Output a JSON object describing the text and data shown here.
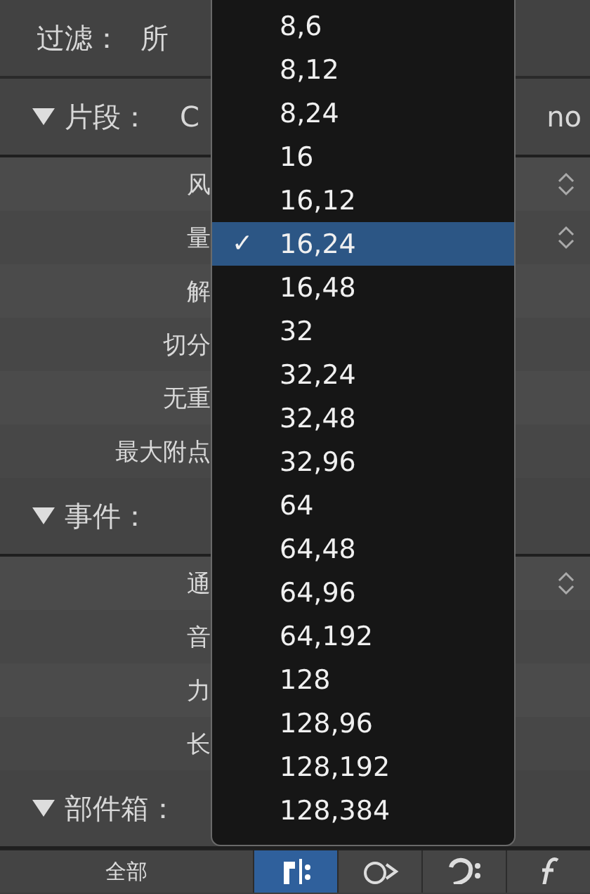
{
  "filter": {
    "label": "过滤：",
    "value": "所"
  },
  "sections": [
    {
      "title": "片段：",
      "value": "C",
      "trailing": "no",
      "expanded": true,
      "rows": [
        {
          "label": "风",
          "kind": "popup"
        },
        {
          "label": "量",
          "kind": "popup"
        },
        {
          "label": "解",
          "kind": "plain"
        },
        {
          "label": "切分",
          "kind": "plain"
        },
        {
          "label": "无重",
          "kind": "plain"
        },
        {
          "label": "最大附点",
          "kind": "plain"
        }
      ]
    },
    {
      "title": "事件：",
      "expanded": true,
      "rows": [
        {
          "label": "通",
          "kind": "popup"
        },
        {
          "label": "音",
          "kind": "plain"
        },
        {
          "label": "力",
          "kind": "plain"
        },
        {
          "label": "长",
          "kind": "plain"
        }
      ]
    },
    {
      "title": "部件箱：",
      "expanded": true
    }
  ],
  "toolbar": {
    "all_button": "全部",
    "tabs": [
      {
        "kind": "notes",
        "selected": true
      },
      {
        "kind": "symbols",
        "selected": false
      },
      {
        "kind": "clef",
        "selected": false
      },
      {
        "kind": "dynamics",
        "selected": false
      }
    ]
  },
  "menu": {
    "items": [
      {
        "label": "8,6",
        "selected": false
      },
      {
        "label": "8,12",
        "selected": false
      },
      {
        "label": "8,24",
        "selected": false
      },
      {
        "label": "16",
        "selected": false
      },
      {
        "label": "16,12",
        "selected": false
      },
      {
        "label": "16,24",
        "selected": true
      },
      {
        "label": "16,48",
        "selected": false
      },
      {
        "label": "32",
        "selected": false
      },
      {
        "label": "32,24",
        "selected": false
      },
      {
        "label": "32,48",
        "selected": false
      },
      {
        "label": "32,96",
        "selected": false
      },
      {
        "label": "64",
        "selected": false
      },
      {
        "label": "64,48",
        "selected": false
      },
      {
        "label": "64,96",
        "selected": false
      },
      {
        "label": "64,192",
        "selected": false
      },
      {
        "label": "128",
        "selected": false
      },
      {
        "label": "128,96",
        "selected": false
      },
      {
        "label": "128,192",
        "selected": false
      },
      {
        "label": "128,384",
        "selected": false
      }
    ],
    "check": "✓"
  }
}
